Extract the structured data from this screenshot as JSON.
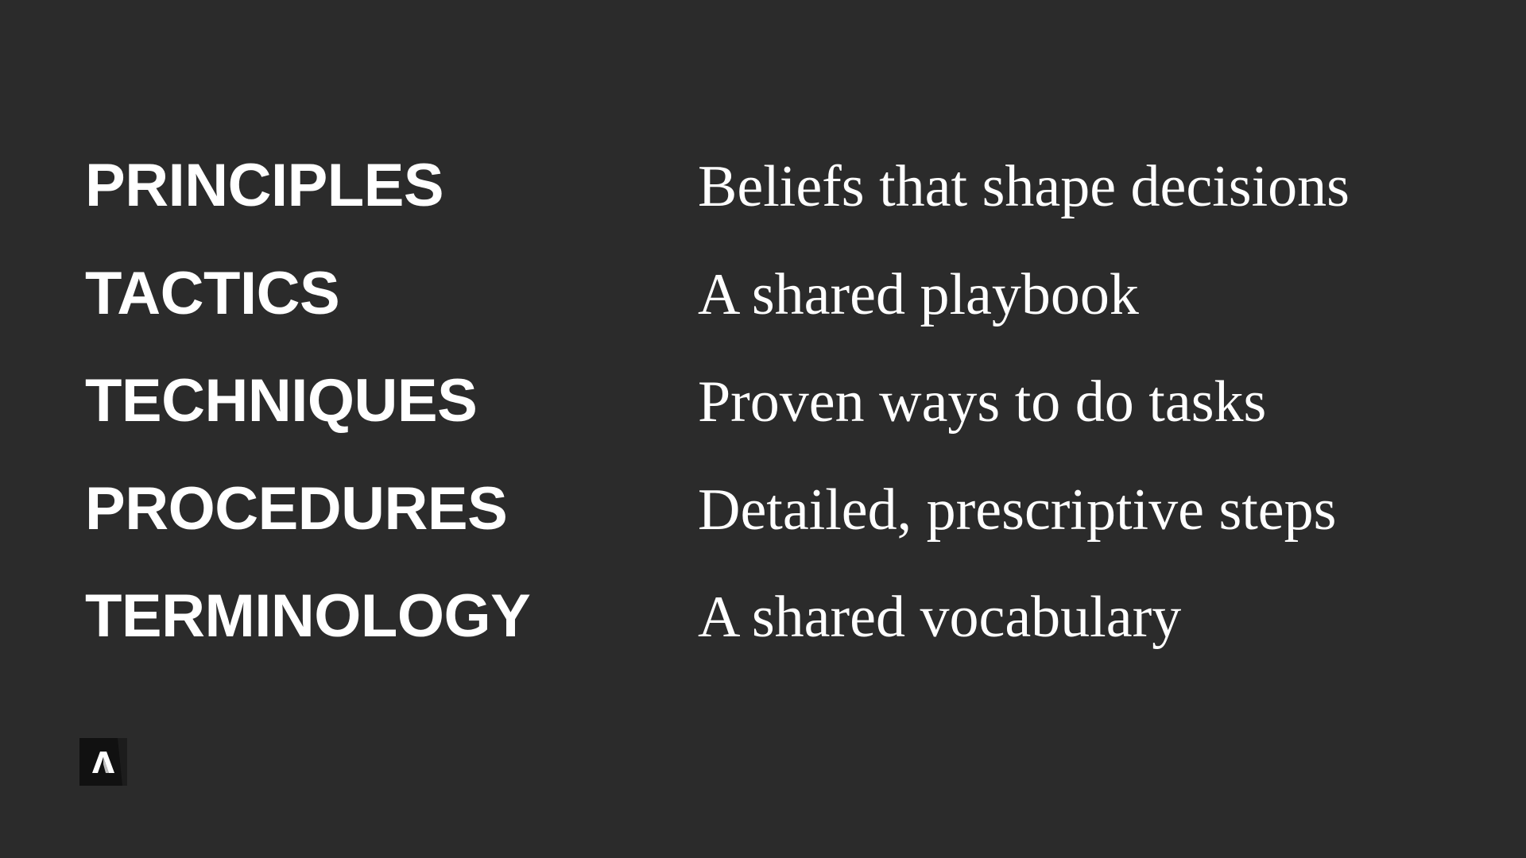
{
  "rows": [
    {
      "term": "PRINCIPLES",
      "description": "Beliefs that shape decisions"
    },
    {
      "term": "TACTICS",
      "description": "A shared playbook"
    },
    {
      "term": "TECHNIQUES",
      "description": "Proven ways to do tasks"
    },
    {
      "term": "PROCEDURES",
      "description": "Detailed, prescriptive steps"
    },
    {
      "term": "TERMINOLOGY",
      "description": "A shared vocabulary"
    }
  ],
  "logo": {
    "icon": "brand-logo-icon"
  },
  "colors": {
    "background": "#2b2b2b",
    "text": "#ffffff",
    "logo_background": "#111111"
  }
}
